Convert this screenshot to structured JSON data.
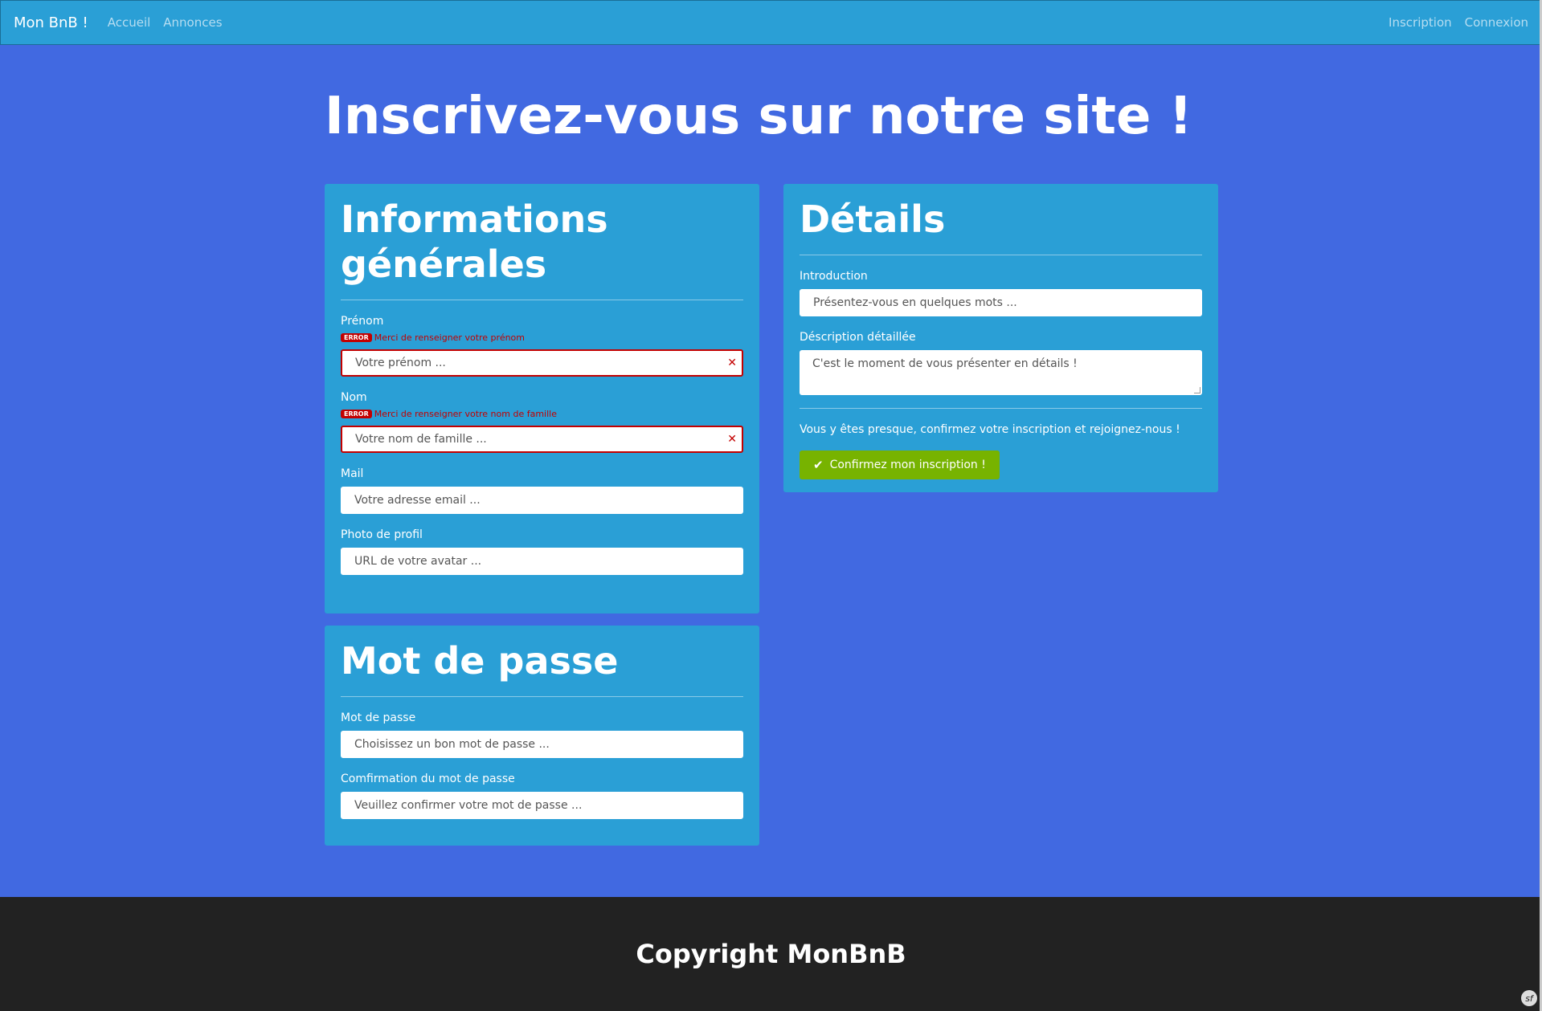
{
  "navbar": {
    "brand": "Mon BnB !",
    "left_links": [
      "Accueil",
      "Annonces"
    ],
    "right_links": [
      "Inscription",
      "Connexion"
    ]
  },
  "page": {
    "title": "Inscrivez-vous sur notre site !"
  },
  "info_card": {
    "title": "Informations générales",
    "firstname": {
      "label": "Prénom",
      "error_badge": "ERROR",
      "error": "Merci de renseigner votre prénom",
      "placeholder": "Votre prénom ..."
    },
    "lastname": {
      "label": "Nom",
      "error_badge": "ERROR",
      "error": "Merci de renseigner votre nom de famille",
      "placeholder": "Votre nom de famille ..."
    },
    "mail": {
      "label": "Mail",
      "placeholder": "Votre adresse email ..."
    },
    "picture": {
      "label": "Photo de profil",
      "placeholder": "URL de votre avatar ..."
    }
  },
  "password_card": {
    "title": "Mot de passe",
    "password": {
      "label": "Mot de passe",
      "placeholder": "Choisissez un bon mot de passe ..."
    },
    "confirm": {
      "label": "Comfirmation du mot de passe",
      "placeholder": "Veuillez confirmer votre mot de passe ..."
    }
  },
  "details_card": {
    "title": "Détails",
    "intro": {
      "label": "Introduction",
      "placeholder": "Présentez-vous en quelques mots ..."
    },
    "description": {
      "label": "Déscription détaillée",
      "placeholder": "C'est le moment de vous présenter en détails !"
    },
    "confirm_text": "Vous y êtes presque, confirmez votre inscription et rejoignez-nous !",
    "submit_label": "Confirmez mon inscription !"
  },
  "footer": {
    "text": "Copyright MonBnB",
    "symfony_icon": "sf"
  },
  "colors": {
    "background": "#4169e1",
    "navbar": "#2a9fd6",
    "card": "#2a9fd6",
    "error": "#c30000",
    "success": "#77b300",
    "footer": "#222222"
  }
}
